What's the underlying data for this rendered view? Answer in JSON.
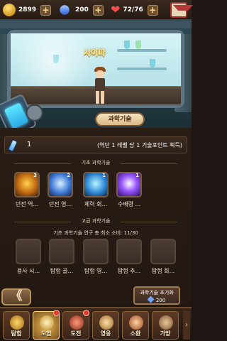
{
  "topbar": {
    "gold": "2899",
    "gems": "200",
    "energy": "72/76",
    "plus_label": "+"
  },
  "scene": {
    "character_name": "사이파"
  },
  "title_tab": "과학기술",
  "points": {
    "value": "1",
    "description": "(역단 1 레벨 당 1 기술포인트 획득)"
  },
  "basic_section": {
    "label": "기초 과학기술",
    "skills": [
      {
        "name": "던전 역...",
        "count": "3"
      },
      {
        "name": "던전 영...",
        "count": "2"
      },
      {
        "name": "체력 회...",
        "count": "1"
      },
      {
        "name": "수배령 ...",
        "count": "1"
      }
    ]
  },
  "advanced_section": {
    "label": "고급 과학기술",
    "requirement": "기초 과학기술 연구 총 최소 소비: 11/30",
    "skills": [
      {
        "name": "용사 시..."
      },
      {
        "name": "탐험 골..."
      },
      {
        "name": "탐험 영..."
      },
      {
        "name": "탐험 추..."
      },
      {
        "name": "탐험 회..."
      }
    ]
  },
  "back_button": "《",
  "reset": {
    "label": "과학기술 초기화",
    "cost": "200"
  },
  "nav": {
    "items": [
      {
        "label": "탐험"
      },
      {
        "label": "모험"
      },
      {
        "label": "도전"
      },
      {
        "label": "영웅"
      },
      {
        "label": "소환"
      },
      {
        "label": "가방"
      }
    ],
    "more": "›"
  },
  "colors": {
    "accent_gold": "#ffe88a",
    "panel_bg": "#2a1d16",
    "badge_red": "#e23b2a"
  }
}
